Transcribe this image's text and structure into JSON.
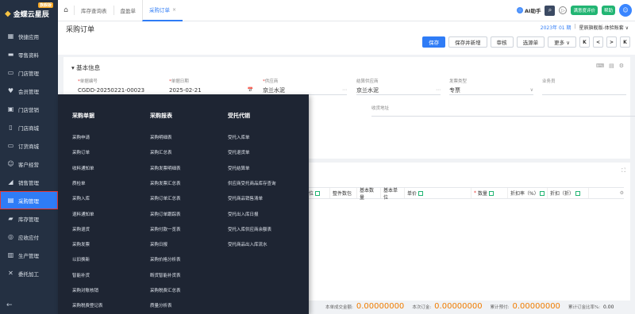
{
  "brand": {
    "name": "金蝶云星辰",
    "badge": "旗舰版"
  },
  "sidebar": {
    "items": [
      {
        "label": "快捷应用",
        "icon": "grid-icon"
      },
      {
        "label": "零售资料",
        "icon": "retail-icon"
      },
      {
        "label": "门店管理",
        "icon": "store-icon"
      },
      {
        "label": "会员管理",
        "icon": "member-icon"
      },
      {
        "label": "门店营销",
        "icon": "marketing-icon"
      },
      {
        "label": "门店商城",
        "icon": "mall-icon"
      },
      {
        "label": "订货商城",
        "icon": "order-mall-icon"
      },
      {
        "label": "客户经营",
        "icon": "customer-icon"
      },
      {
        "label": "销售管理",
        "icon": "sales-icon"
      },
      {
        "label": "采购管理",
        "icon": "purchase-icon"
      },
      {
        "label": "库存管理",
        "icon": "inventory-icon"
      },
      {
        "label": "应收应付",
        "icon": "finance-icon"
      },
      {
        "label": "生产管理",
        "icon": "production-icon"
      },
      {
        "label": "委托加工",
        "icon": "process-icon"
      }
    ],
    "collapse_icon": "←"
  },
  "tabs": [
    {
      "label": "库存查询表",
      "active": false
    },
    {
      "label": "盘盈单",
      "active": false
    },
    {
      "label": "采购订单",
      "active": true
    }
  ],
  "topbar": {
    "ai_label": "AI助手",
    "trial_label": "满意度评价",
    "help_label": "帮助"
  },
  "page": {
    "title": "采购订单",
    "period": "2023年 01 期",
    "org": "星辰旗舰版-体验账套 ∨"
  },
  "actions": [
    {
      "label": "保存",
      "primary": true
    },
    {
      "label": "保存并新增",
      "primary": false
    },
    {
      "label": "审核",
      "primary": false
    },
    {
      "label": "选源单",
      "primary": false
    },
    {
      "label": "更多 ∨",
      "primary": false
    }
  ],
  "nav": [
    "K",
    "<",
    ">",
    "K"
  ],
  "basic": {
    "title": "▾ 基本信息",
    "fields": [
      {
        "label": "单据编号",
        "required": true,
        "value": "CGDD-20250221-00023",
        "icon": ""
      },
      {
        "label": "单据日期",
        "required": true,
        "value": "2025-02-21",
        "icon": "📅"
      },
      {
        "label": "供应商",
        "required": true,
        "value": "京兰水泥",
        "icon": "⋯"
      },
      {
        "label": "结算供应商",
        "required": false,
        "value": "京兰水泥",
        "icon": "⋯"
      },
      {
        "label": "发票类型",
        "required": false,
        "value": "专票",
        "icon": "∨"
      },
      {
        "label": "业务员",
        "required": false,
        "value": "",
        "icon": ""
      }
    ],
    "address_label": "收货地址"
  },
  "table": {
    "columns": [
      {
        "label": "单位",
        "checkbox": true,
        "required": false
      },
      {
        "label": "整件数包",
        "checkbox": false,
        "required": false
      },
      {
        "label": "基本数量",
        "checkbox": false,
        "required": false
      },
      {
        "label": "基本单位",
        "checkbox": false,
        "required": false
      },
      {
        "label": "单价",
        "checkbox": true,
        "required": false
      },
      {
        "label": "数量",
        "checkbox": true,
        "required": true
      },
      {
        "label": "折扣率（%）",
        "checkbox": true,
        "required": false
      },
      {
        "label": "折扣（折）",
        "checkbox": true,
        "required": false
      }
    ]
  },
  "footer": {
    "items": [
      {
        "label": "本单成交金额:",
        "value": "0.00000000"
      },
      {
        "label": "本次订金:",
        "value": "0.00000000"
      },
      {
        "label": "累计预付:",
        "value": "0.00000000"
      }
    ],
    "ratio_label": "累计订金比率%:",
    "ratio_value": "0.00"
  },
  "menu": {
    "columns": [
      {
        "heading": "采购单据",
        "items": [
          "采购申请",
          "采购订单",
          "收料通知单",
          "质检单",
          "采购入库",
          "退料通知单",
          "采购退货",
          "采购发票",
          "以旧换新",
          "智能补货",
          "采购对账核销",
          "采购税费登记表",
          "金士顿"
        ]
      },
      {
        "heading": "采购报表",
        "items": [
          "采购明细表",
          "采购汇总表",
          "采购发票明细表",
          "采购发票汇总表",
          "采购订单汇总表",
          "采购订单跟踪表",
          "采购付款一览表",
          "采购日报",
          "采购价格分析表",
          "断货智能补货表",
          "采购税费汇总表",
          "质量分析表",
          "金士顿数据分析表"
        ]
      },
      {
        "heading": "受托代销",
        "items": [
          "受托入库单",
          "受托退货单",
          "受托结算单",
          "供应商受托商品库存查询",
          "受托商品销售清单",
          "受托出入库日报",
          "受托入库供应商余额表",
          "受托商品出入库流水"
        ]
      }
    ]
  }
}
